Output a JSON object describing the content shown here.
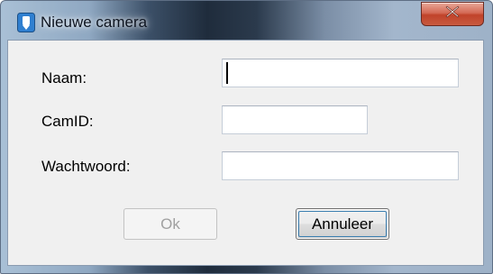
{
  "window": {
    "title": "Nieuwe camera",
    "app_icon": "camera-app-icon",
    "close_icon": "close-icon",
    "close_label": "X"
  },
  "form": {
    "name_label": "Naam:",
    "name_value": "",
    "camid_label": "CamID:",
    "camid_value": "",
    "password_label": "Wachtwoord:",
    "password_value": ""
  },
  "buttons": {
    "ok_label": "Ok",
    "ok_enabled": false,
    "cancel_label": "Annuleer"
  },
  "colors": {
    "close_button": "#c8452c",
    "dialog_background": "#f0f0f0",
    "disabled_text": "#a0a0a0"
  }
}
